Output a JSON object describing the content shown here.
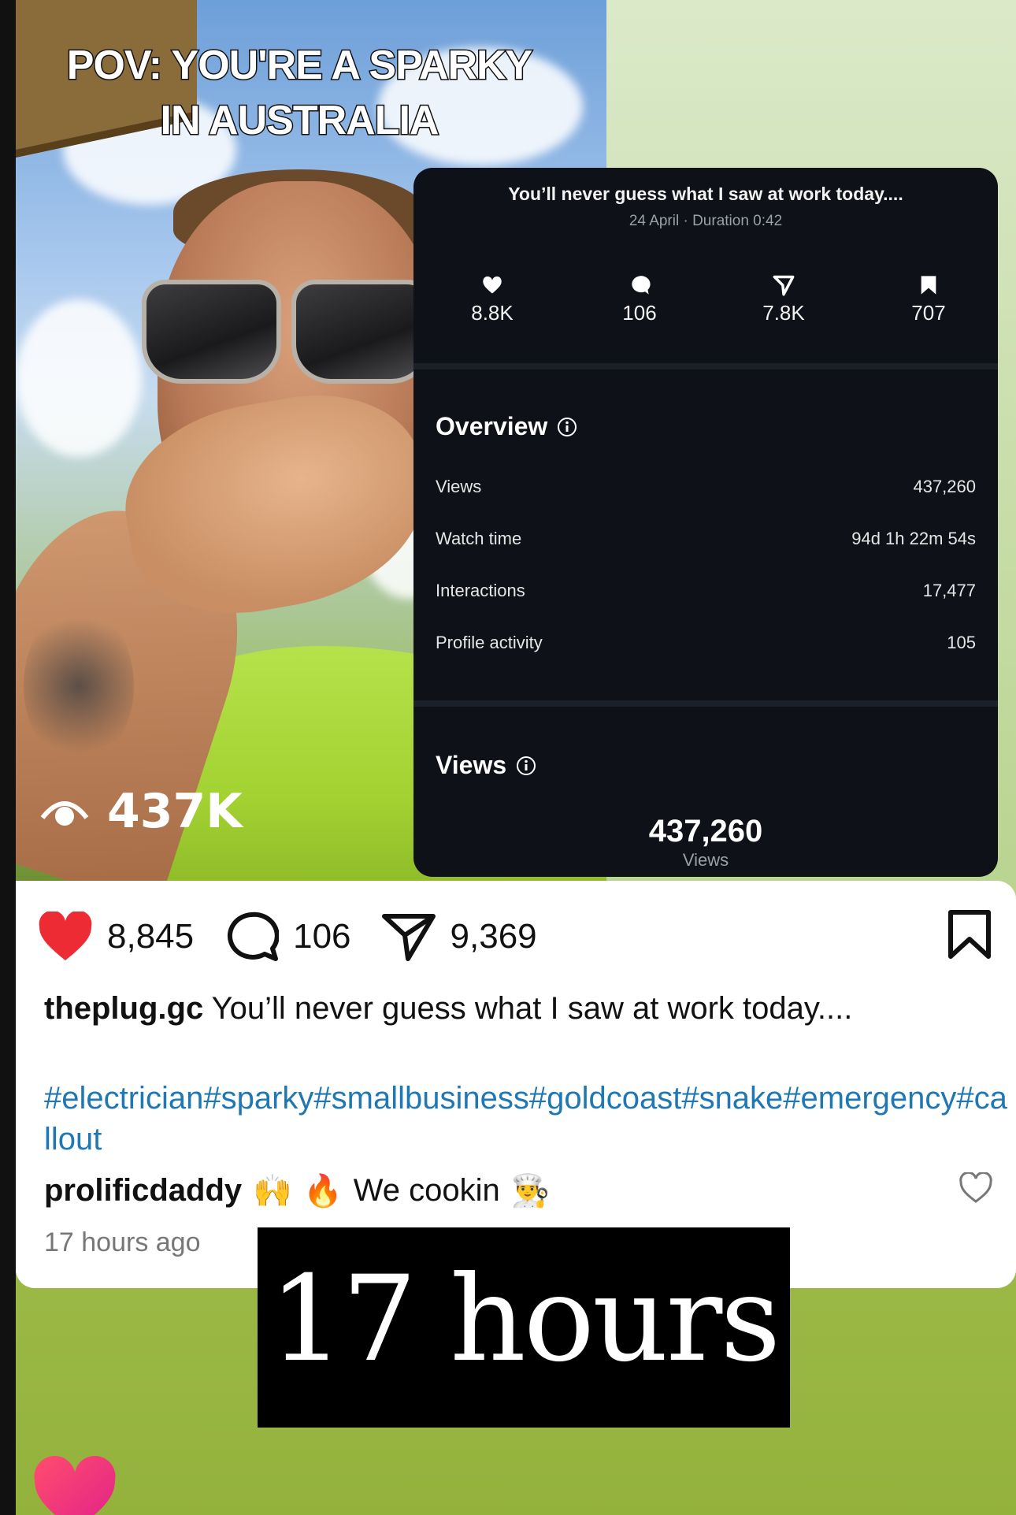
{
  "video": {
    "overlay_text_line1": "POV: YOU'RE A SPARKY",
    "overlay_text_line2": "IN AUSTRALIA",
    "views_badge": "437K"
  },
  "analytics": {
    "title": "You’ll never guess what I saw at work today....",
    "subtitle": "24 April · Duration 0:42",
    "stats": [
      {
        "icon": "heart-icon",
        "value": "8.8K"
      },
      {
        "icon": "comment-icon",
        "value": "106"
      },
      {
        "icon": "share-icon",
        "value": "7.8K"
      },
      {
        "icon": "bookmark-icon",
        "value": "707"
      }
    ],
    "overview_title": "Overview",
    "overview_rows": [
      {
        "label": "Views",
        "value": "437,260"
      },
      {
        "label": "Watch time",
        "value": "94d 1h 22m 54s"
      },
      {
        "label": "Interactions",
        "value": "17,477"
      },
      {
        "label": "Profile activity",
        "value": "105"
      }
    ],
    "views_title": "Views",
    "views_total": "437,260",
    "views_label": "Views"
  },
  "post": {
    "likes": "8,845",
    "comments": "106",
    "shares": "9,369",
    "username": "theplug.gc",
    "caption": "You’ll never guess what I saw at work today....",
    "hashtags": "#electrician#sparky#smallbusiness#goldcoast#snake#emergency#callout",
    "comment_user": "prolificdaddy",
    "comment_emoji_1": "🙌",
    "comment_emoji_2": "🔥",
    "comment_text": "We cookin",
    "comment_emoji_3": "👨‍🍳",
    "time_ago": "17 hours ago"
  },
  "label": {
    "hours": "17 hours"
  },
  "colors": {
    "panel_bg": "#0e1117",
    "like_red": "#ed2b35",
    "hashtag_blue": "#1f78b4",
    "background_green": "#93b23c"
  }
}
